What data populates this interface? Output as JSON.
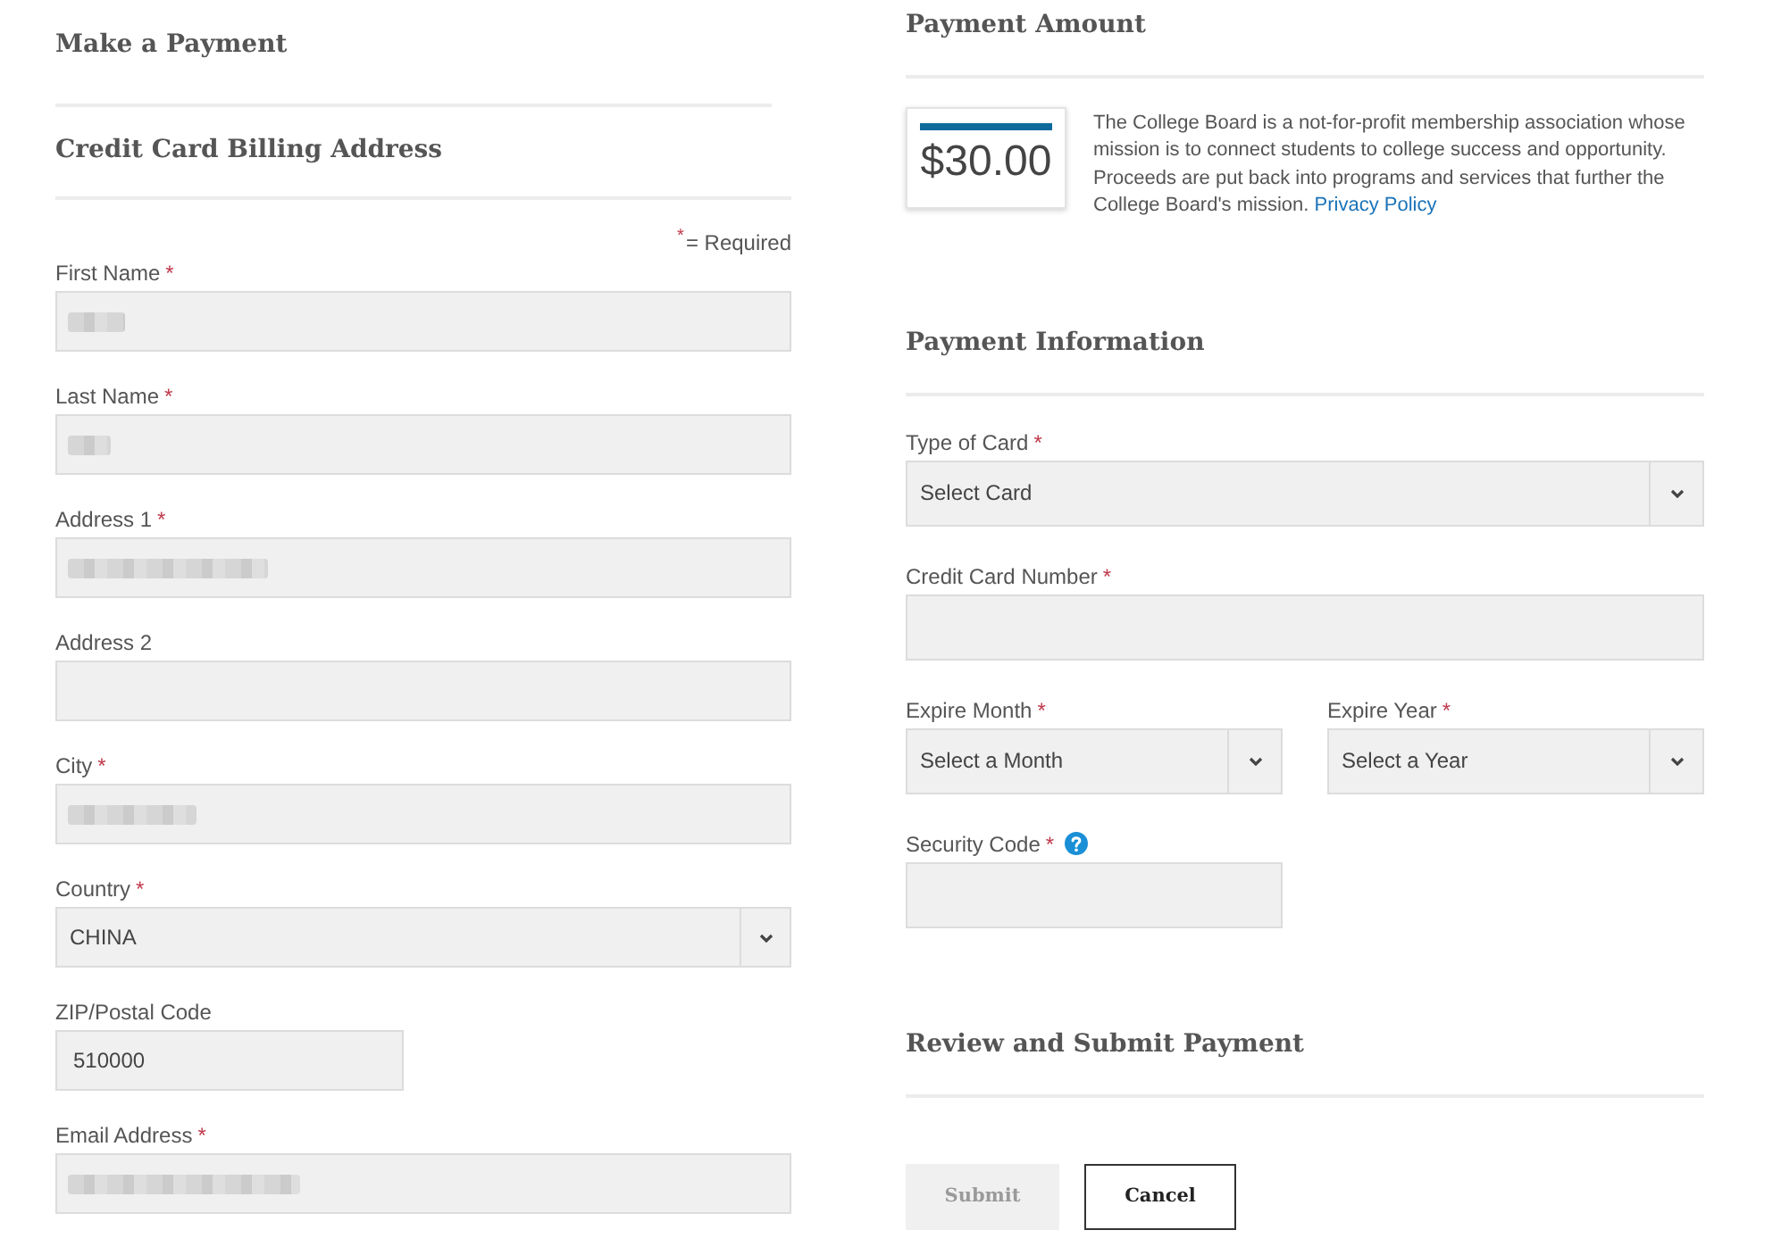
{
  "page": {
    "title": "Make a Payment"
  },
  "billing_address": {
    "heading": "Credit Card Billing Address",
    "required_note": {
      "mark": "*",
      "text": "= Required"
    },
    "fields": [
      {
        "label": "First Name",
        "required_mark": "*",
        "kind": "text",
        "redacted": true
      },
      {
        "label": "Last Name",
        "required_mark": "*",
        "kind": "text",
        "redacted": true
      },
      {
        "label": "Address 1",
        "required_mark": "*",
        "kind": "text",
        "redacted": true
      },
      {
        "label": "Address 2",
        "kind": "text",
        "redacted": false
      },
      {
        "label": "City",
        "required_mark": "*",
        "kind": "text",
        "redacted": true
      },
      {
        "label": "Country",
        "required_mark": "*",
        "kind": "select",
        "value": "CHINA"
      },
      {
        "label": "ZIP/Postal Code",
        "kind": "short",
        "value": "510000",
        "redacted": false
      },
      {
        "label": "Email Address",
        "required_mark": "*",
        "kind": "text",
        "redacted": true
      }
    ]
  },
  "payment_amount": {
    "heading": "Payment Amount",
    "amount": "$30.00",
    "description": "The College Board is a not-for-profit membership association whose mission is to connect students to college success and opportunity. Proceeds are put back into programs and services that further the College Board's mission.",
    "link": "Privacy Policy"
  },
  "payment_information": {
    "heading": "Payment Information",
    "rows": [
      [
        {
          "label": "Type of Card",
          "required_mark": "*",
          "kind": "select",
          "value": "Select Card"
        }
      ],
      [
        {
          "label": "Credit Card Number",
          "required_mark": "*",
          "kind": "text"
        }
      ],
      [
        {
          "label": "Expire Month",
          "required_mark": "*",
          "kind": "select",
          "value": "Select a Month"
        },
        {
          "label": "Expire Year",
          "required_mark": "*",
          "kind": "select",
          "value": "Select a Year"
        }
      ],
      [
        {
          "label": "Security Code",
          "required_mark": "*",
          "kind": "short",
          "help": true
        }
      ]
    ]
  },
  "review": {
    "heading": "Review and Submit Payment",
    "buttons": [
      {
        "label": "Submit",
        "disabled": true
      },
      {
        "label": "Cancel",
        "disabled": false
      }
    ]
  }
}
